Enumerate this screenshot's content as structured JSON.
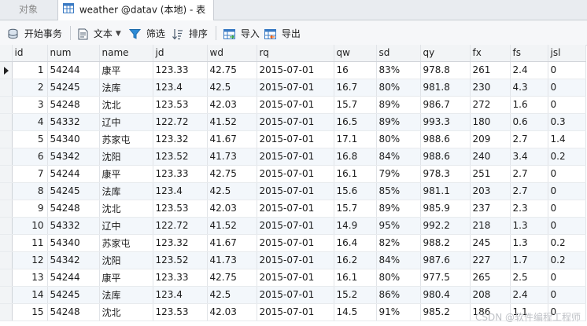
{
  "tabs": {
    "objects_label": "对象",
    "table_tab_label": "weather @datav (本地) - 表"
  },
  "toolbar": {
    "begin_transaction": "开始事务",
    "text": "文本",
    "filter": "筛选",
    "sort": "排序",
    "import": "导入",
    "export": "导出"
  },
  "table": {
    "columns": [
      "id",
      "num",
      "name",
      "jd",
      "wd",
      "rq",
      "qw",
      "sd",
      "qy",
      "fx",
      "fs",
      "jsl"
    ],
    "rows": [
      [
        "1",
        "54244",
        "康平",
        "123.33",
        "42.75",
        "2015-07-01",
        "16",
        "83%",
        "978.8",
        "261",
        "2.4",
        "0"
      ],
      [
        "2",
        "54245",
        "法库",
        "123.4",
        "42.5",
        "2015-07-01",
        "16.7",
        "80%",
        "981.8",
        "230",
        "4.3",
        "0"
      ],
      [
        "3",
        "54248",
        "沈北",
        "123.53",
        "42.03",
        "2015-07-01",
        "15.7",
        "89%",
        "986.7",
        "272",
        "1.6",
        "0"
      ],
      [
        "4",
        "54332",
        "辽中",
        "122.72",
        "41.52",
        "2015-07-01",
        "16.5",
        "89%",
        "993.3",
        "180",
        "0.6",
        "0.3"
      ],
      [
        "5",
        "54340",
        "苏家屯",
        "123.32",
        "41.67",
        "2015-07-01",
        "17.1",
        "80%",
        "988.6",
        "209",
        "2.7",
        "1.4"
      ],
      [
        "6",
        "54342",
        "沈阳",
        "123.52",
        "41.73",
        "2015-07-01",
        "16.8",
        "84%",
        "988.6",
        "240",
        "3.4",
        "0.2"
      ],
      [
        "7",
        "54244",
        "康平",
        "123.33",
        "42.75",
        "2015-07-01",
        "16.1",
        "79%",
        "978.3",
        "251",
        "2.7",
        "0"
      ],
      [
        "8",
        "54245",
        "法库",
        "123.4",
        "42.5",
        "2015-07-01",
        "15.6",
        "85%",
        "981.1",
        "203",
        "2.7",
        "0"
      ],
      [
        "9",
        "54248",
        "沈北",
        "123.53",
        "42.03",
        "2015-07-01",
        "15.7",
        "89%",
        "985.9",
        "237",
        "2.3",
        "0"
      ],
      [
        "10",
        "54332",
        "辽中",
        "122.72",
        "41.52",
        "2015-07-01",
        "14.9",
        "95%",
        "992.2",
        "218",
        "1.3",
        "0"
      ],
      [
        "11",
        "54340",
        "苏家屯",
        "123.32",
        "41.67",
        "2015-07-01",
        "16.4",
        "82%",
        "988.2",
        "245",
        "1.3",
        "0.2"
      ],
      [
        "12",
        "54342",
        "沈阳",
        "123.52",
        "41.73",
        "2015-07-01",
        "16.2",
        "84%",
        "987.6",
        "227",
        "1.7",
        "0.2"
      ],
      [
        "13",
        "54244",
        "康平",
        "123.33",
        "42.75",
        "2015-07-01",
        "16.1",
        "80%",
        "977.5",
        "265",
        "2.5",
        "0"
      ],
      [
        "14",
        "54245",
        "法库",
        "123.4",
        "42.5",
        "2015-07-01",
        "15.2",
        "86%",
        "980.4",
        "208",
        "2.4",
        "0"
      ],
      [
        "15",
        "54248",
        "沈北",
        "123.53",
        "42.03",
        "2015-07-01",
        "14.5",
        "91%",
        "985.2",
        "186",
        "1.1",
        "0"
      ]
    ]
  },
  "watermark": "CSDN @软件编程工程师"
}
